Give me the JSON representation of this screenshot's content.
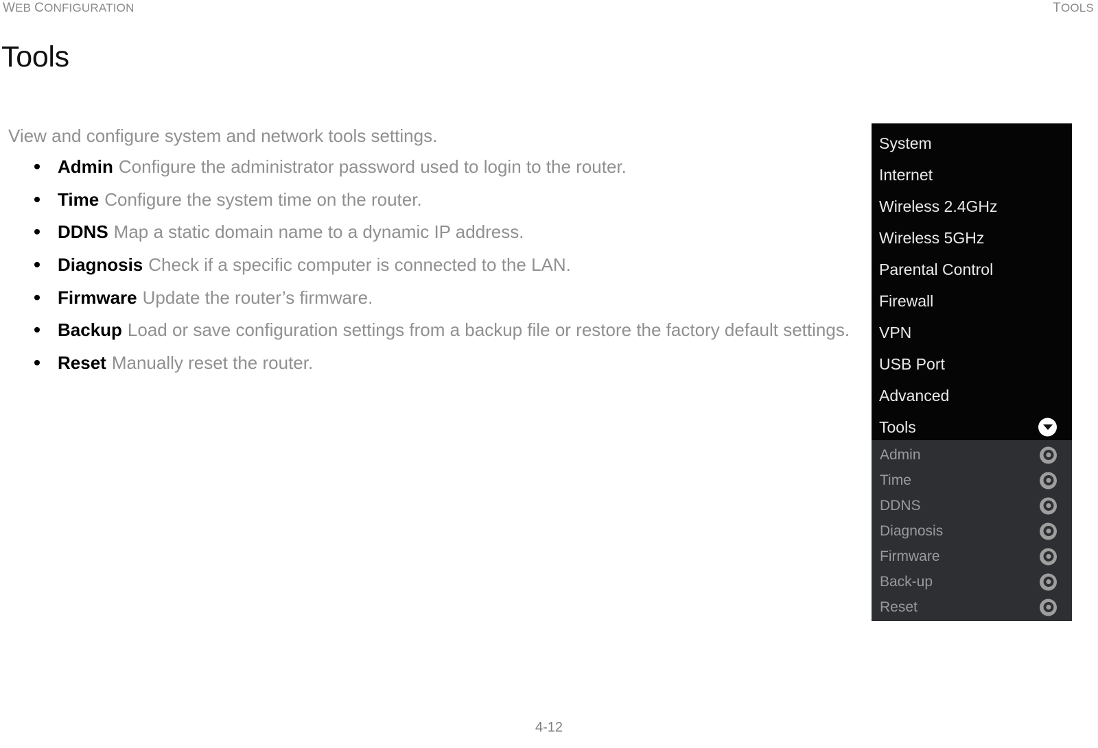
{
  "header": {
    "left_text": "Web Configuration",
    "right_text": "Tools"
  },
  "page_title": "Tools",
  "intro": "View and configure system and network tools settings.",
  "bullets": [
    {
      "term": "Admin",
      "desc": "Configure the administrator password used to login to the router."
    },
    {
      "term": "Time",
      "desc": "Configure the system time on the router."
    },
    {
      "term": "DDNS",
      "desc": "Map a static domain name to a dynamic IP address."
    },
    {
      "term": "Diagnosis",
      "desc": "Check if a specific computer is connected to the LAN."
    },
    {
      "term": "Firmware",
      "desc": "Update the router’s firmware."
    },
    {
      "term": "Backup",
      "desc": "Load or save configuration settings from a backup file or restore the factory default settings."
    },
    {
      "term": "Reset",
      "desc": "Manually reset the router."
    }
  ],
  "footer": {
    "page_number": "4-12"
  },
  "nav_panel": {
    "main_items": [
      {
        "label": "System",
        "icon": ""
      },
      {
        "label": "Internet",
        "icon": ""
      },
      {
        "label": "Wireless 2.4GHz",
        "icon": ""
      },
      {
        "label": "Wireless 5GHz",
        "icon": ""
      },
      {
        "label": "Parental Control",
        "icon": ""
      },
      {
        "label": "Firewall",
        "icon": ""
      },
      {
        "label": "VPN",
        "icon": ""
      },
      {
        "label": "USB Port",
        "icon": ""
      },
      {
        "label": "Advanced",
        "icon": ""
      },
      {
        "label": "Tools",
        "icon": "chevron-down-circle-icon"
      }
    ],
    "sub_items": [
      {
        "label": "Admin",
        "icon": "ring-icon"
      },
      {
        "label": "Time",
        "icon": "ring-icon"
      },
      {
        "label": "DDNS",
        "icon": "ring-icon"
      },
      {
        "label": "Diagnosis",
        "icon": "ring-icon"
      },
      {
        "label": "Firmware",
        "icon": "ring-icon"
      },
      {
        "label": "Back-up",
        "icon": "ring-icon"
      },
      {
        "label": "Reset",
        "icon": "ring-icon"
      }
    ]
  },
  "colors": {
    "nav_background": "#050505",
    "sub_background": "#2d2f33",
    "body_text": "#909090",
    "term_text": "#000000"
  }
}
